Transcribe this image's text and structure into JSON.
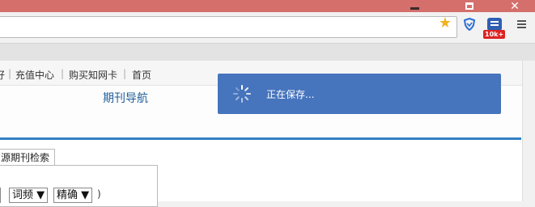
{
  "browser": {
    "window_controls": {
      "minimize": "minimize",
      "maximize": "maximize",
      "close": "✕"
    },
    "extension_badge": "10k+",
    "icons": {
      "bookmark": "star-icon",
      "shield": "shield-icon",
      "extension": "extension-icon",
      "menu": "menu-icon"
    },
    "colors": {
      "titlebar": "#d46f6c",
      "accent": "#3381c3",
      "toast": "#4674bd"
    }
  },
  "topnav": {
    "items": [
      "好",
      "充值中心",
      "购买知网卡",
      "首页"
    ]
  },
  "page": {
    "nav_title": "期刊导航",
    "search_tab": "源期刊检索",
    "selects": [
      {
        "label": "词频",
        "arrow": "▼"
      },
      {
        "label": "精确",
        "arrow": "▼"
      }
    ],
    "paren": ")"
  },
  "toast": {
    "text": "正在保存..."
  }
}
